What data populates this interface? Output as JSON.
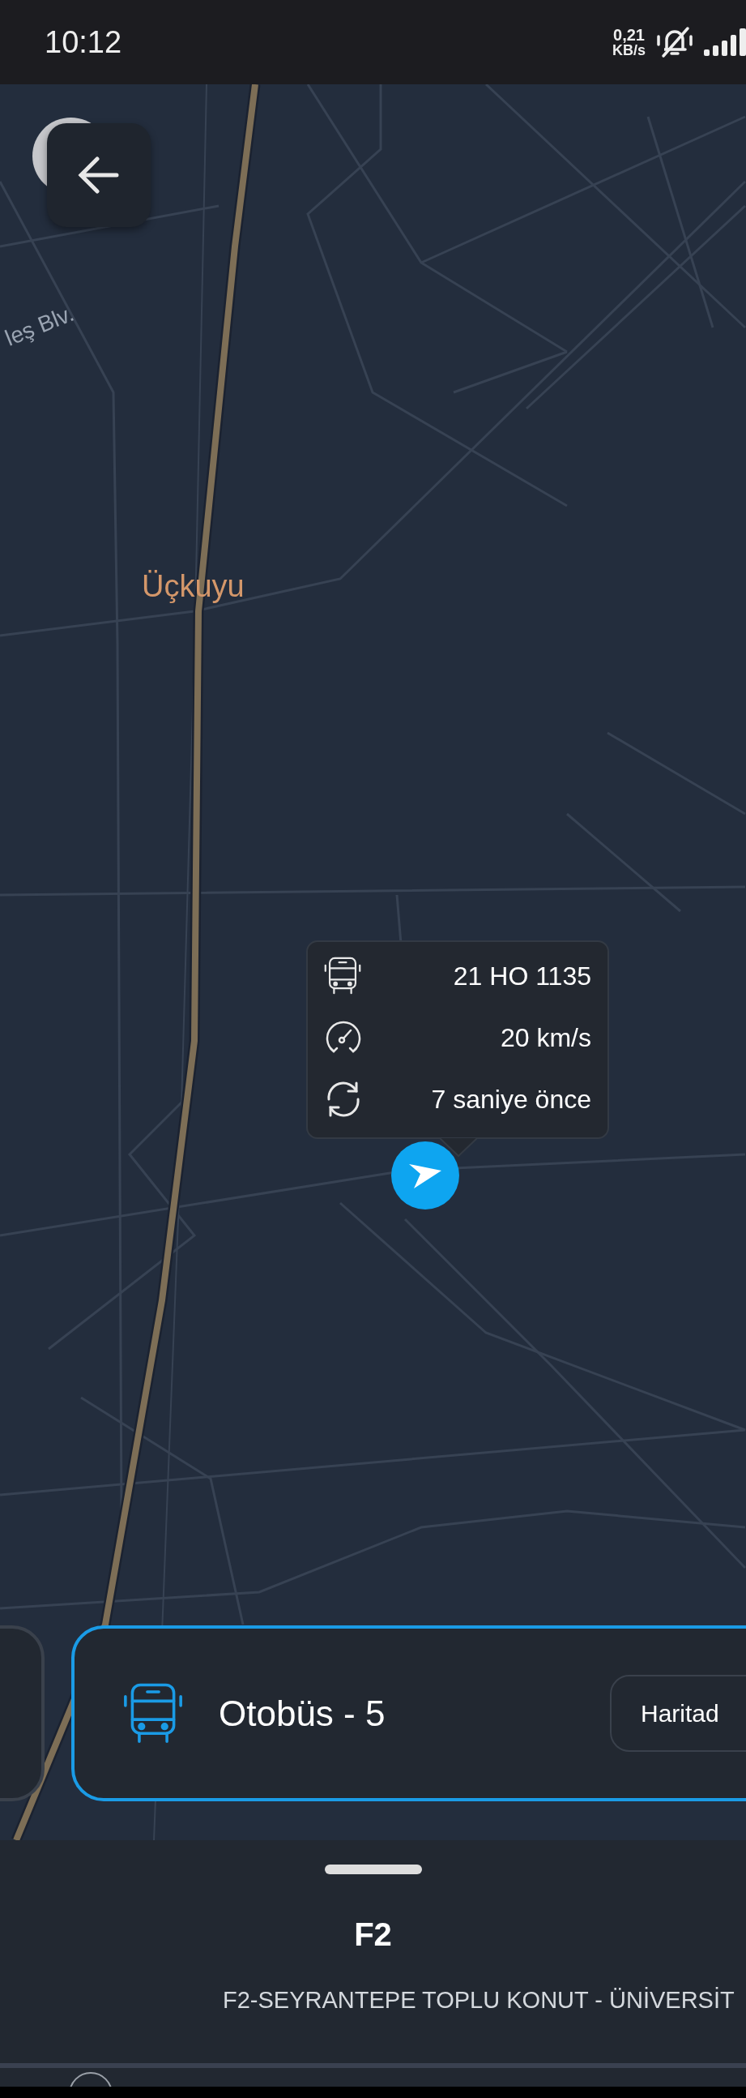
{
  "status_bar": {
    "time": "10:12",
    "net_speed_value": "0,21",
    "net_speed_unit": "KB/s"
  },
  "map": {
    "labels": [
      {
        "kind": "street",
        "text": "leş Blv."
      },
      {
        "kind": "place",
        "text": "Üçkuyu"
      }
    ]
  },
  "vehicle_popup": {
    "rows": [
      {
        "kind": "bus",
        "text": "21 HO 1135"
      },
      {
        "kind": "speed",
        "text": "20 km/s"
      },
      {
        "kind": "updated",
        "text": "7 saniye önce"
      }
    ]
  },
  "vehicle_cards": [
    {
      "selected": false
    },
    {
      "selected": true,
      "title": "Otobüs - 5",
      "button": "Haritad"
    }
  ],
  "bottom_sheet": {
    "title": "F2",
    "subtitle": "F2-SEYRANTEPE TOPLU KONUT - ÜNİVERSİT"
  }
}
